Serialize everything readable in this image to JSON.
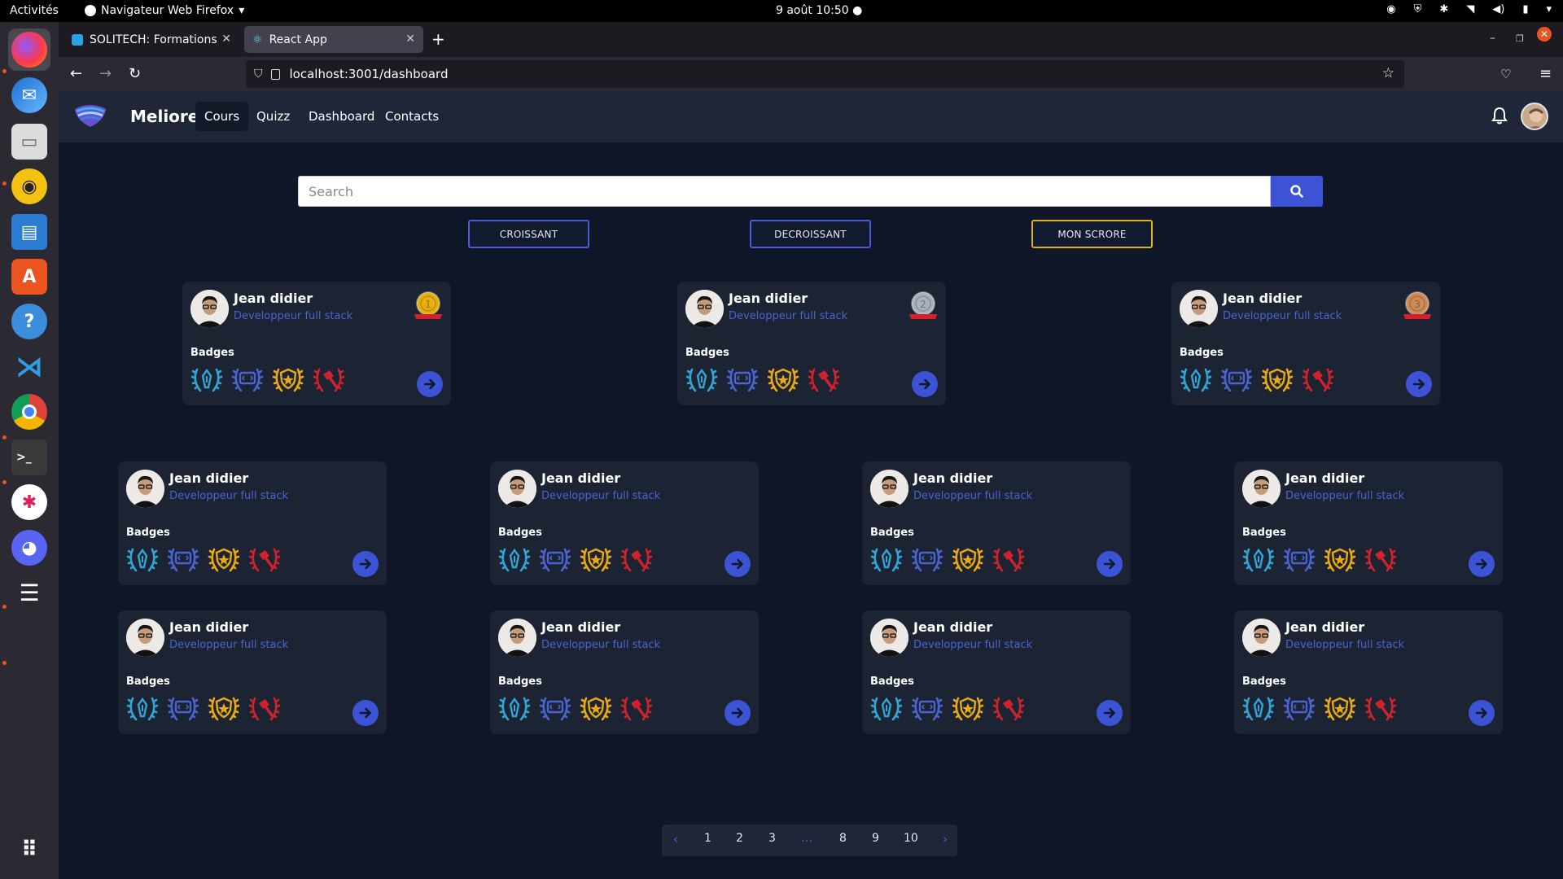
{
  "system": {
    "activities": "Activités",
    "app_menu": "Navigateur Web Firefox",
    "clock": "9 août  10:50"
  },
  "browser": {
    "tabs": [
      {
        "label": "SOLITECH: Formations"
      },
      {
        "label": "React App"
      }
    ],
    "url": "localhost:3001/dashboard"
  },
  "app": {
    "brand": "Meliorem",
    "nav": [
      {
        "label": "Cours",
        "active": true
      },
      {
        "label": "Quizz",
        "active": false
      },
      {
        "label": "Dashboard",
        "active": false
      },
      {
        "label": "Contacts",
        "active": false
      }
    ],
    "search": {
      "placeholder": "Search",
      "value": ""
    },
    "sort_buttons": [
      {
        "label": "CROISSANT"
      },
      {
        "label": "DECROISSANT"
      },
      {
        "label": "MON SCRORE"
      }
    ],
    "badges_label": "Badges",
    "podium": [
      {
        "name": "Jean didier",
        "role": "Developpeur full stack",
        "rank": "1",
        "medal_color": "#e8b00c"
      },
      {
        "name": "Jean didier",
        "role": "Developpeur full stack",
        "rank": "2",
        "medal_color": "#aab3bd"
      },
      {
        "name": "Jean didier",
        "role": "Developpeur full stack",
        "rank": "3",
        "medal_color": "#d08a55"
      }
    ],
    "grid": [
      {
        "name": "Jean didier",
        "role": "Developpeur full stack"
      },
      {
        "name": "Jean didier",
        "role": "Developpeur full stack"
      },
      {
        "name": "Jean didier",
        "role": "Developpeur full stack"
      },
      {
        "name": "Jean didier",
        "role": "Developpeur full stack"
      },
      {
        "name": "Jean didier",
        "role": "Developpeur full stack"
      },
      {
        "name": "Jean didier",
        "role": "Developpeur full stack"
      },
      {
        "name": "Jean didier",
        "role": "Developpeur full stack"
      },
      {
        "name": "Jean didier",
        "role": "Developpeur full stack"
      }
    ],
    "badge_icons": [
      {
        "name": "pen-badge-icon",
        "color": "#2fa6d6"
      },
      {
        "name": "code-badge-icon",
        "color": "#4a63cf"
      },
      {
        "name": "shield-badge-icon",
        "color": "#e8a914"
      },
      {
        "name": "hammer-badge-icon",
        "color": "#d0222c"
      }
    ],
    "pagination": [
      "1",
      "2",
      "3",
      "…",
      "8",
      "9",
      "10"
    ]
  }
}
